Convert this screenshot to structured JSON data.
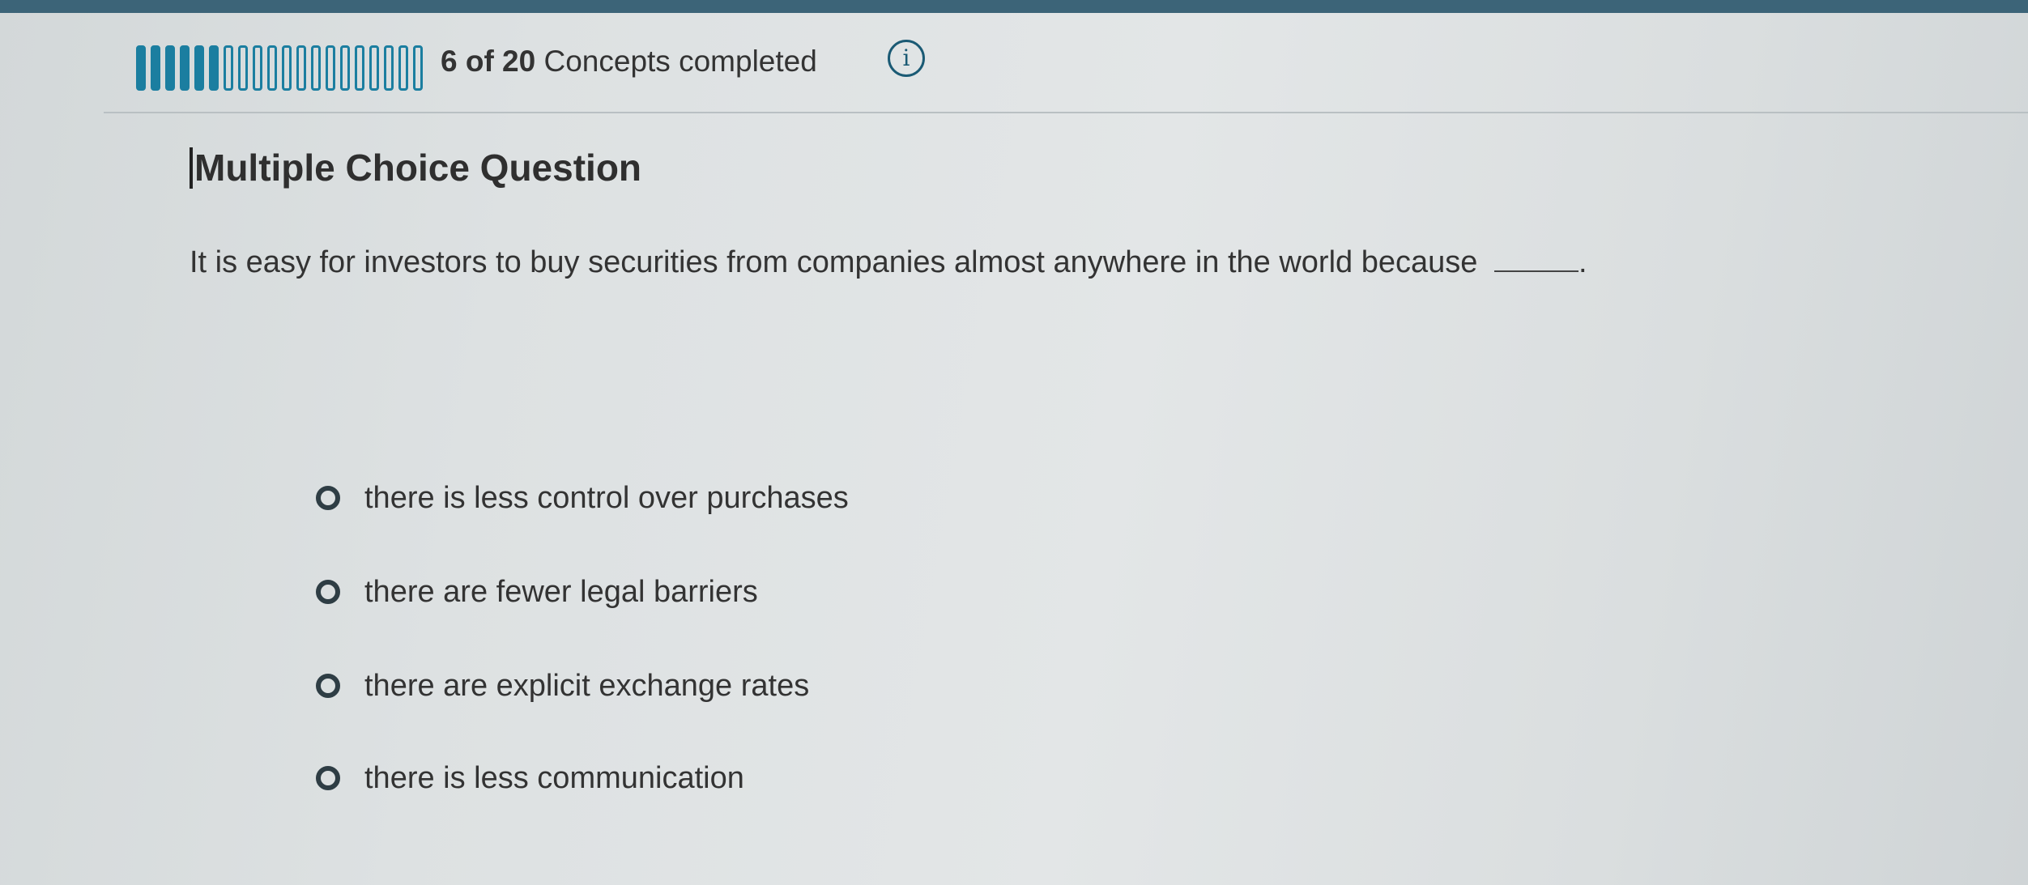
{
  "header": {
    "progress": {
      "completed": 6,
      "total": 20,
      "fraction": 0.3
    },
    "progress_count": "6 of 20",
    "progress_label": "Concepts completed",
    "info_icon": "info-icon",
    "accent_color": "#1b7ea0",
    "topbar_color": "#3c6478"
  },
  "question": {
    "heading": "Multiple Choice Question",
    "text": "It is easy for investors to buy securities from companies almost anywhere in the world because",
    "trailing_punctuation": ".",
    "options": [
      {
        "label": "there is less control over purchases",
        "selected": false
      },
      {
        "label": "there are fewer legal barriers",
        "selected": false
      },
      {
        "label": "there are explicit exchange rates",
        "selected": false
      },
      {
        "label": "there is less communication",
        "selected": false
      }
    ]
  }
}
